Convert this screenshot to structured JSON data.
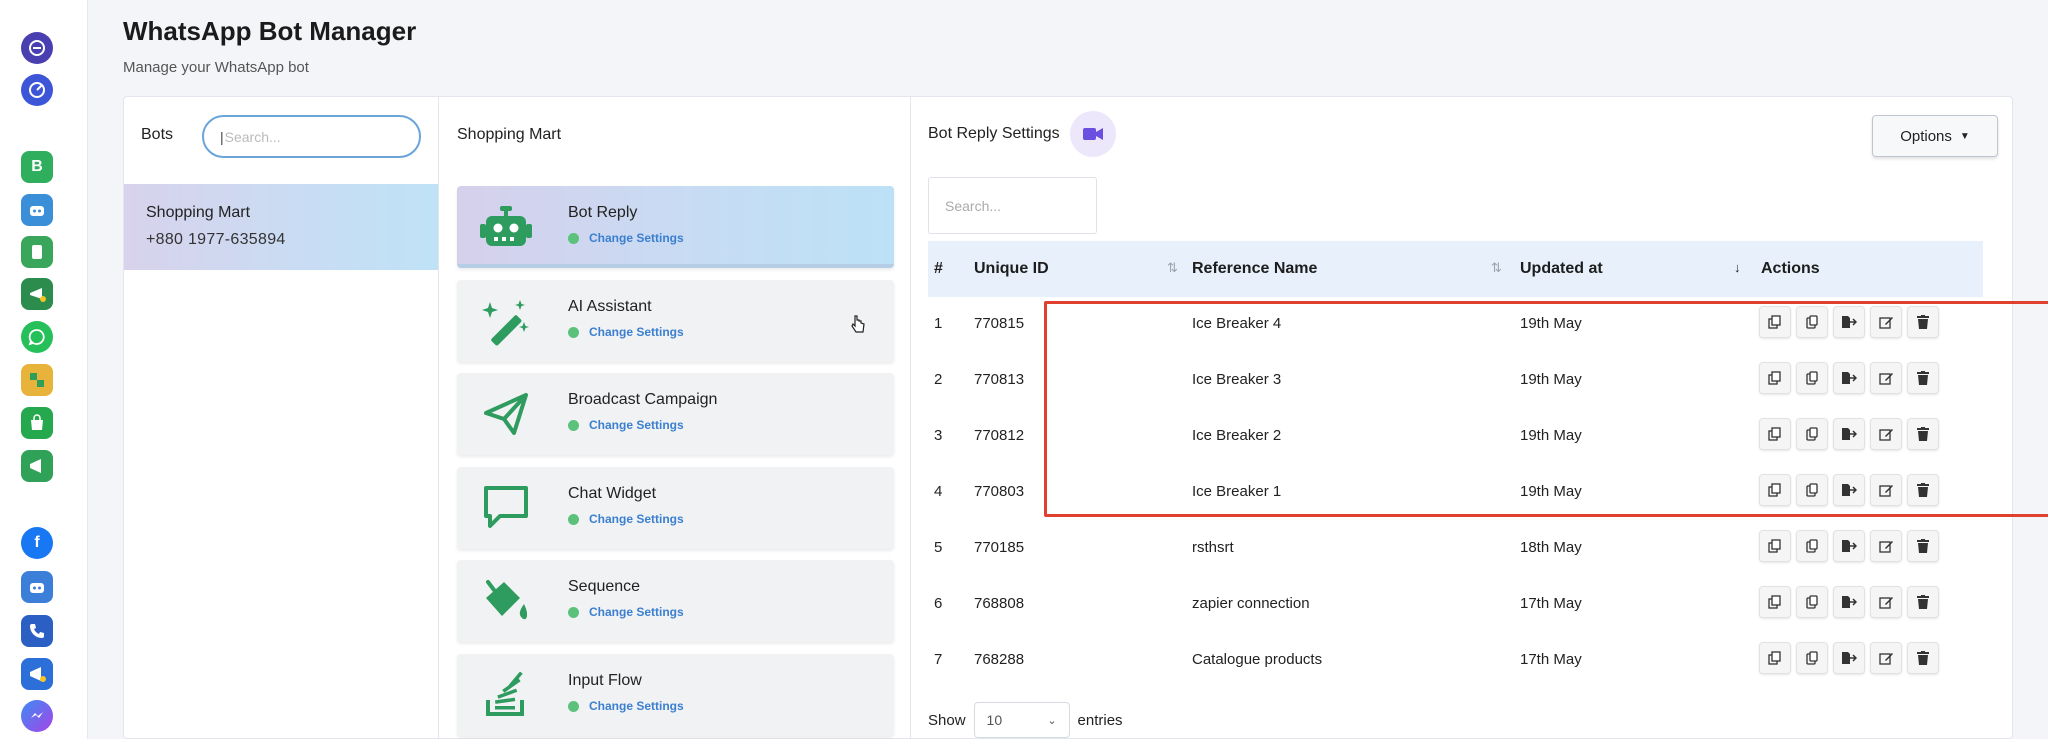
{
  "page": {
    "title": "WhatsApp Bot Manager",
    "subtitle": "Manage your WhatsApp bot"
  },
  "rail": {
    "icons": [
      "profile-icon",
      "dashboard-icon",
      "whatsapp-business-icon",
      "bot-icon",
      "phone-doc-icon",
      "campaign-icon",
      "whatsapp-icon",
      "integration-icon",
      "shop-icon",
      "broadcast-icon",
      "facebook-icon",
      "messenger-bot-icon",
      "call-icon",
      "send-campaign-icon",
      "messenger-icon"
    ]
  },
  "bots": {
    "title": "Bots",
    "search_placeholder": "Search...",
    "items": [
      {
        "name": "Shopping Mart",
        "phone": "+880 1977-635894"
      }
    ]
  },
  "features": {
    "title": "Shopping Mart",
    "link_label": "Change Settings",
    "items": [
      {
        "name": "Bot Reply",
        "icon": "robot-icon"
      },
      {
        "name": "AI Assistant",
        "icon": "magic-wand-icon"
      },
      {
        "name": "Broadcast Campaign",
        "icon": "paper-plane-icon"
      },
      {
        "name": "Chat Widget",
        "icon": "chat-bubble-icon"
      },
      {
        "name": "Sequence",
        "icon": "paint-bucket-icon"
      },
      {
        "name": "Input Flow",
        "icon": "stack-icon"
      }
    ]
  },
  "settings": {
    "title": "Bot Reply Settings",
    "options_label": "Options",
    "search_placeholder": "Search...",
    "columns": [
      "#",
      "Unique ID",
      "Reference Name",
      "Updated at",
      "Actions"
    ],
    "rows": [
      {
        "n": "1",
        "id": "770815",
        "name": "Ice Breaker 4",
        "updated": "19th May"
      },
      {
        "n": "2",
        "id": "770813",
        "name": "Ice Breaker 3",
        "updated": "19th May"
      },
      {
        "n": "3",
        "id": "770812",
        "name": "Ice Breaker 2",
        "updated": "19th May"
      },
      {
        "n": "4",
        "id": "770803",
        "name": "Ice Breaker 1",
        "updated": "19th May"
      },
      {
        "n": "5",
        "id": "770185",
        "name": "rsthsrt",
        "updated": "18th May"
      },
      {
        "n": "6",
        "id": "768808",
        "name": "zapier connection",
        "updated": "17th May"
      },
      {
        "n": "7",
        "id": "768288",
        "name": "Catalogue products",
        "updated": "17th May"
      }
    ],
    "action_icons": [
      "copy-icon",
      "duplicate-icon",
      "export-icon",
      "edit-icon",
      "delete-icon"
    ],
    "show_label": "Show",
    "page_size": "10",
    "entries_label": "entries"
  },
  "colors": {
    "accent_green": "#2e9b5f",
    "link_blue": "#3b7fd0",
    "highlight_red": "#e0412e",
    "status_dot": "#5cc27b"
  }
}
